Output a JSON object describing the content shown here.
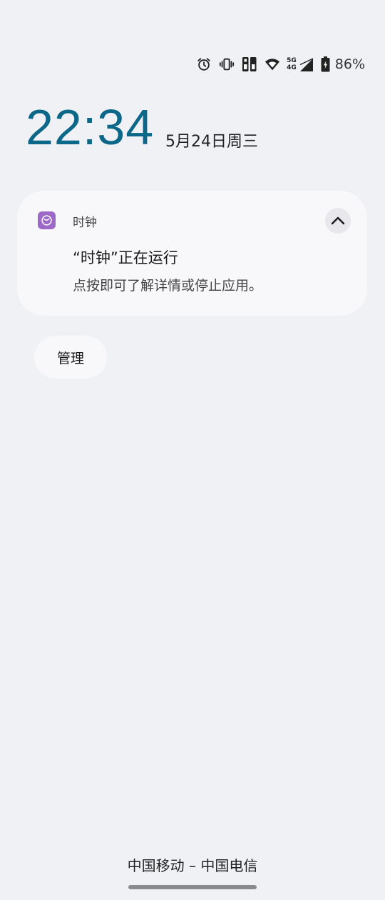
{
  "status_bar": {
    "icons": [
      "alarm-icon",
      "vibrate-icon",
      "sim-card-icon",
      "wifi-icon",
      "signal-icon",
      "battery-icon"
    ],
    "network_top": "5G",
    "network_bottom": "4G",
    "battery_percent": "86%"
  },
  "lock_screen": {
    "time": "22:34",
    "date": "5月24日周三"
  },
  "notification": {
    "app_name": "时钟",
    "app_icon": "clock-app-icon",
    "title": "“时钟”正在运行",
    "body": "点按即可了解详情或停止应用。",
    "expand_icon": "chevron-up-icon"
  },
  "manage_button": {
    "label": "管理"
  },
  "carrier": {
    "text": "中国移动 – 中国电信"
  },
  "colors": {
    "background": "#eff1f4",
    "clock": "#0c6789",
    "card": "#f8f8fa",
    "app_icon": "#9d69c6"
  }
}
